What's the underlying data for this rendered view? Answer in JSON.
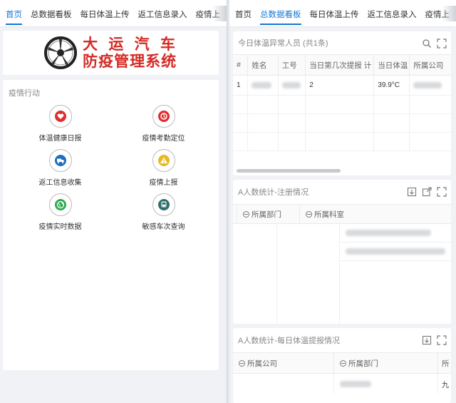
{
  "left": {
    "tabs": [
      "首页",
      "总数据看板",
      "每日体温上传",
      "返工信息录入",
      "疫情上"
    ],
    "active_tab": 0,
    "logo": {
      "line1": "大 运 汽 车",
      "line2": "防疫管理系统"
    },
    "section_title": "疫情行动",
    "actions": [
      {
        "label": "体温健康日报",
        "icon": "heart-icon",
        "color": "#e02e2e"
      },
      {
        "label": "疫情考勤定位",
        "icon": "location-icon",
        "color": "#e02e2e"
      },
      {
        "label": "返工信息收集",
        "icon": "truck-icon",
        "color": "#1f6fbf"
      },
      {
        "label": "疫情上报",
        "icon": "warning-icon",
        "color": "#e8b921"
      },
      {
        "label": "疫情实时数据",
        "icon": "globe-icon",
        "color": "#2fa84f"
      },
      {
        "label": "敏感车次查询",
        "icon": "bus-icon",
        "color": "#2f6f6a"
      }
    ]
  },
  "right": {
    "tabs": [
      "首页",
      "总数据看板",
      "每日体温上传",
      "返工信息录入",
      "疫情上"
    ],
    "active_tab": 1,
    "abnormal_card": {
      "title": "今日体温异常人员 (共1条)",
      "columns": [
        "#",
        "姓名",
        "工号",
        "当日第几次提报 计",
        "当日体温",
        "所属公司"
      ],
      "rows": [
        {
          "idx": "1",
          "count": "2",
          "temp": "39.9°C"
        }
      ]
    },
    "register_card": {
      "title": "A人数统计-注册情况",
      "columns": [
        "所属部门",
        "所属科室"
      ]
    },
    "daily_card": {
      "title": "A人数统计-每日体温提报情况",
      "columns": [
        "所属公司",
        "所属部门",
        "所"
      ],
      "tail_char": "九"
    }
  }
}
